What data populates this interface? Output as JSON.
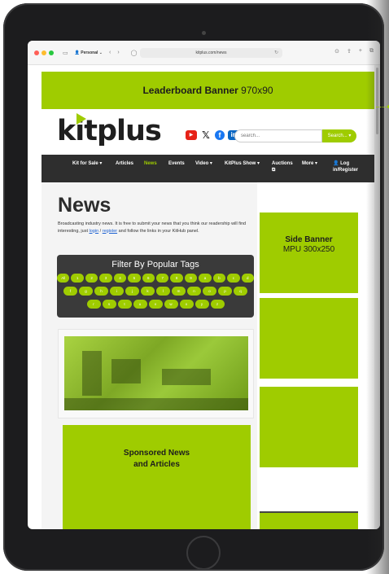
{
  "browser": {
    "profile": "Personal",
    "url": "kitplus.com/news"
  },
  "ads": {
    "leaderboard_bold": "Leaderboard Banner",
    "leaderboard_size": "970x90",
    "side_banner_bold": "Side Banner",
    "side_banner_size": "MPU 300x250",
    "sponsored_line1": "Sponsored News",
    "sponsored_line2": "and Articles"
  },
  "header": {
    "logo": "kitplus",
    "search_placeholder": "search...",
    "search_button": "Search... ▾"
  },
  "nav": {
    "items": [
      {
        "label": "Kit for Sale ▾"
      },
      {
        "label": "Articles"
      },
      {
        "label": "News",
        "active": true
      },
      {
        "label": "Events"
      },
      {
        "label": "Video ▾"
      },
      {
        "label": "KitPlus Show ▾"
      },
      {
        "label": "Auctions"
      },
      {
        "label": "More ▾"
      },
      {
        "label": "Log in/Register"
      }
    ]
  },
  "main": {
    "title": "News",
    "intro_before": "Broadcasting industry news. It is free to submit your news that you think our readership will find interesting, just ",
    "intro_login": "login",
    "intro_sep": " / ",
    "intro_register": "register",
    "intro_after": " and follow the links in your KitHub panel.",
    "filter_title": "Filter By Popular Tags",
    "tag_rows": [
      [
        "All",
        "1",
        "2",
        "3",
        "4",
        "5",
        "6",
        "7",
        "8",
        "9",
        "a",
        "b",
        "c",
        "d"
      ],
      [
        "f",
        "g",
        "h",
        "i",
        "j",
        "k",
        "l",
        "m",
        "n",
        "o",
        "p",
        "q"
      ],
      [
        "r",
        "s",
        "t",
        "u",
        "v",
        "w",
        "x",
        "y",
        "z"
      ]
    ]
  },
  "colors": {
    "accent": "#9fcc00",
    "nav_bg": "#2e2e2e",
    "tablet": "#1c1c1e"
  },
  "icons": [
    "youtube-icon",
    "x-icon",
    "facebook-icon",
    "linkedin-icon"
  ]
}
